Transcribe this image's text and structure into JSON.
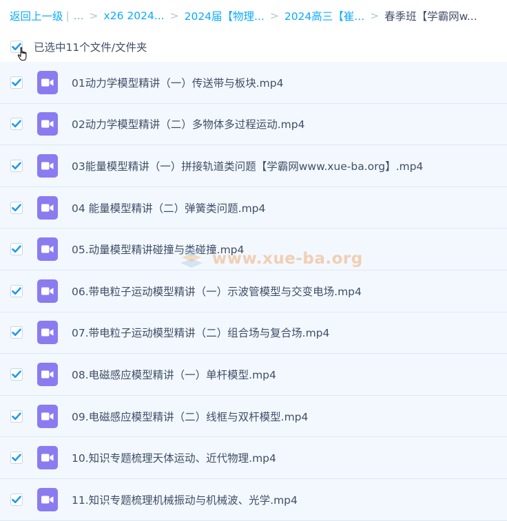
{
  "breadcrumb": {
    "back": "返回上一级",
    "pipe": "|",
    "ellipsis": "...",
    "items": [
      "x26 2024...",
      "2024届【物理...",
      "2024高三【崔...",
      "春季班【学霸网w..."
    ]
  },
  "select_all": {
    "label": "已选中11个文件/文件夹",
    "checked": true
  },
  "files": [
    {
      "name": "01动力学模型精讲（一）传送带与板块.mp4",
      "checked": true
    },
    {
      "name": "02动力学模型精讲（二）多物体多过程运动.mp4",
      "checked": true
    },
    {
      "name": "03能量模型精讲（一）拼接轨道类问题【学霸网www.xue-ba.org】.mp4",
      "checked": true
    },
    {
      "name": "04 能量模型精讲（二）弹簧类问题.mp4",
      "checked": true
    },
    {
      "name": "05.动量模型精讲碰撞与类碰撞.mp4",
      "checked": true
    },
    {
      "name": "06.带电粒子运动模型精讲（一）示波管模型与交变电场.mp4",
      "checked": true
    },
    {
      "name": "07.带电粒子运动模型精讲（二）组合场与复合场.mp4",
      "checked": true
    },
    {
      "name": "08.电磁感应模型精讲（一）单杆模型.mp4",
      "checked": true
    },
    {
      "name": "09.电磁感应模型精讲（二）线框与双杆模型.mp4",
      "checked": true
    },
    {
      "name": "10.知识专题梳理天体运动、近代物理.mp4",
      "checked": true
    },
    {
      "name": "11.知识专题梳理机械振动与机械波、光学.mp4",
      "checked": true
    }
  ],
  "watermark": {
    "text": "www.xue-ba.org"
  },
  "icons": {
    "checkbox": "checkmark-icon",
    "file": "video-file-icon",
    "cursor": "hand-pointer-icon"
  },
  "colors": {
    "link": "#09aaff",
    "text": "#424e67",
    "check": "#1a9af0",
    "video_icon": "#8b7bf0",
    "row_bg": "#f2f8fe"
  }
}
